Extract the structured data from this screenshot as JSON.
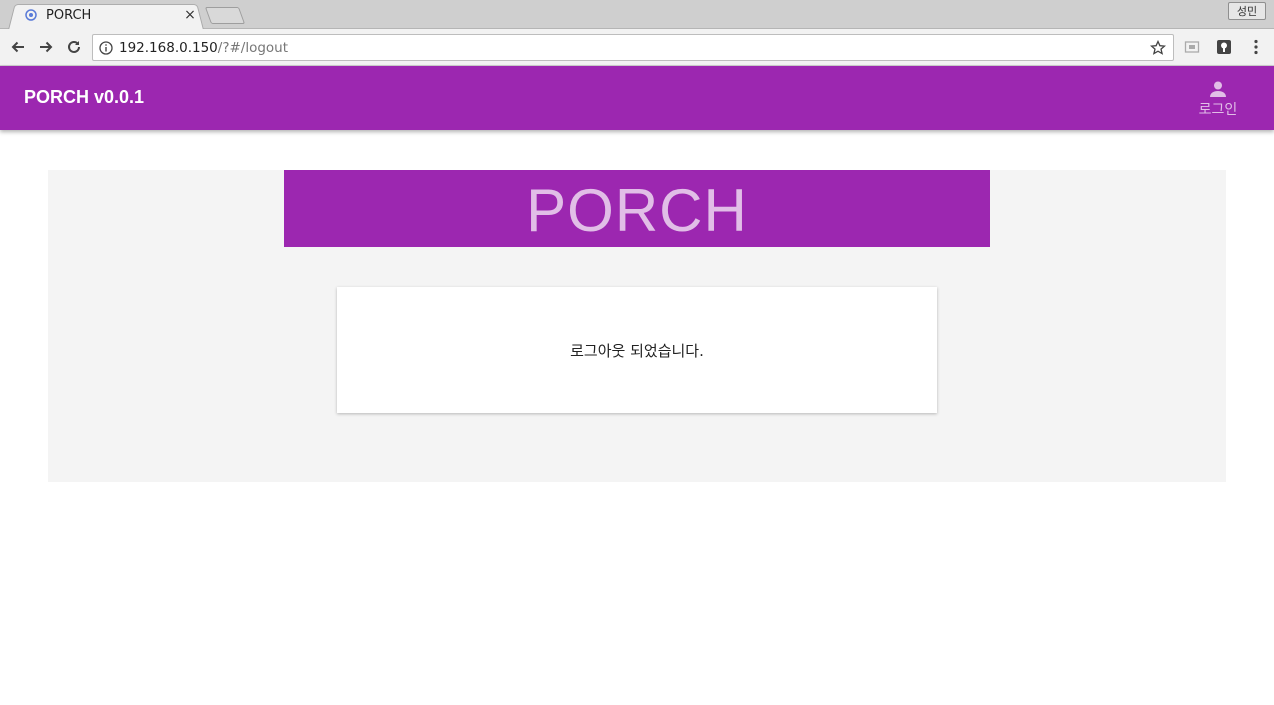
{
  "browser": {
    "tab": {
      "title": "PORCH",
      "close_glyph": "×"
    },
    "profile_label": "성민",
    "url": {
      "host": "192.168.0.150",
      "path": "/?#/logout"
    },
    "icons": {
      "back": "arrow-left-icon",
      "forward": "arrow-right-icon",
      "reload": "reload-icon",
      "info": "info-icon",
      "bookmark": "star-icon",
      "menu": "kebab-menu-icon"
    }
  },
  "appbar": {
    "title": "PORCH v0.0.1",
    "login_label": "로그인",
    "background": "#9c27b0",
    "accent_text": "#e1bee7"
  },
  "main": {
    "banner_text": "PORCH",
    "message": "로그아웃 되었습니다."
  }
}
